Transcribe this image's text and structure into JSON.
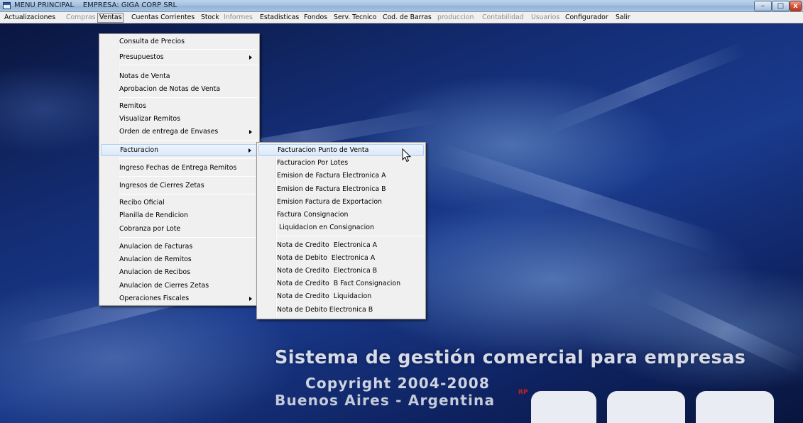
{
  "window": {
    "title": "MENU PRINCIPAL    EMPRESA: GIGA CORP SRL",
    "minimize_glyph": "–",
    "maximize_glyph": "□",
    "close_glyph": "x"
  },
  "menubar": {
    "items": [
      {
        "label": "Actualizaciones",
        "enabled": true
      },
      {
        "label": "Compras",
        "enabled": false
      },
      {
        "label": "Ventas",
        "enabled": true,
        "open": true
      },
      {
        "label": "Cuentas Corrientes",
        "enabled": true
      },
      {
        "label": "Stock",
        "enabled": true
      },
      {
        "label": "Informes",
        "enabled": false
      },
      {
        "label": "Estadisticas",
        "enabled": true
      },
      {
        "label": "Fondos",
        "enabled": true
      },
      {
        "label": "Serv. Tecnico",
        "enabled": true
      },
      {
        "label": "Cod. de Barras",
        "enabled": true
      },
      {
        "label": "produccion",
        "enabled": false
      },
      {
        "label": "Contabilidad",
        "enabled": false
      },
      {
        "label": "Usuarios",
        "enabled": false
      },
      {
        "label": "Configurador",
        "enabled": true
      },
      {
        "label": "Salir",
        "enabled": true
      }
    ]
  },
  "ventas_menu": {
    "items": [
      {
        "label": "Consulta de Precios"
      },
      {
        "label": "Presupuestos",
        "submenu": true
      },
      {
        "label": "Notas de Venta"
      },
      {
        "label": "Aprobacion de Notas de Venta"
      },
      {
        "label": "Remitos"
      },
      {
        "label": "Visualizar Remitos"
      },
      {
        "label": "Orden de entrega de Envases",
        "submenu": true
      },
      {
        "label": "Facturacion",
        "submenu": true,
        "highlighted": true
      },
      {
        "label": "Ingreso Fechas de Entrega Remitos"
      },
      {
        "label": "Ingresos de Cierres Zetas"
      },
      {
        "label": "Recibo Oficial"
      },
      {
        "label": "Planilla de Rendicion"
      },
      {
        "label": "Cobranza por Lote"
      },
      {
        "label": "Anulacion de Facturas"
      },
      {
        "label": "Anulacion de Remitos"
      },
      {
        "label": "Anulacion de Recibos"
      },
      {
        "label": "Anulacion de Cierres Zetas"
      },
      {
        "label": "Operaciones Fiscales",
        "submenu": true
      }
    ]
  },
  "facturacion_menu": {
    "items": [
      {
        "label": "Facturacion Punto de Venta",
        "highlighted": true
      },
      {
        "label": "Facturacion Por Lotes"
      },
      {
        "label": "Emision de Factura Electronica A"
      },
      {
        "label": "Emision de Factura Electronica B"
      },
      {
        "label": "Emision Factura de Exportacion"
      },
      {
        "label": "Factura Consignacion"
      },
      {
        "label": " Liquidacion en Consignacion"
      },
      {
        "label": "Nota de Credito  Electronica A"
      },
      {
        "label": "Nota de Debito  Electronica A"
      },
      {
        "label": "Nota de Credito  Electronica B"
      },
      {
        "label": "Nota de Credito  B Fact Consignacion"
      },
      {
        "label": "Nota de Credito  Liquidacion"
      },
      {
        "label": "Nota de Debito Electronica B"
      }
    ]
  },
  "background": {
    "slogan": "Sistema de gestión comercial para empresas",
    "copyright": "Copyright 2004-2008",
    "location": "Buenos Aires - Argentina",
    "logo_mark": "RP"
  }
}
